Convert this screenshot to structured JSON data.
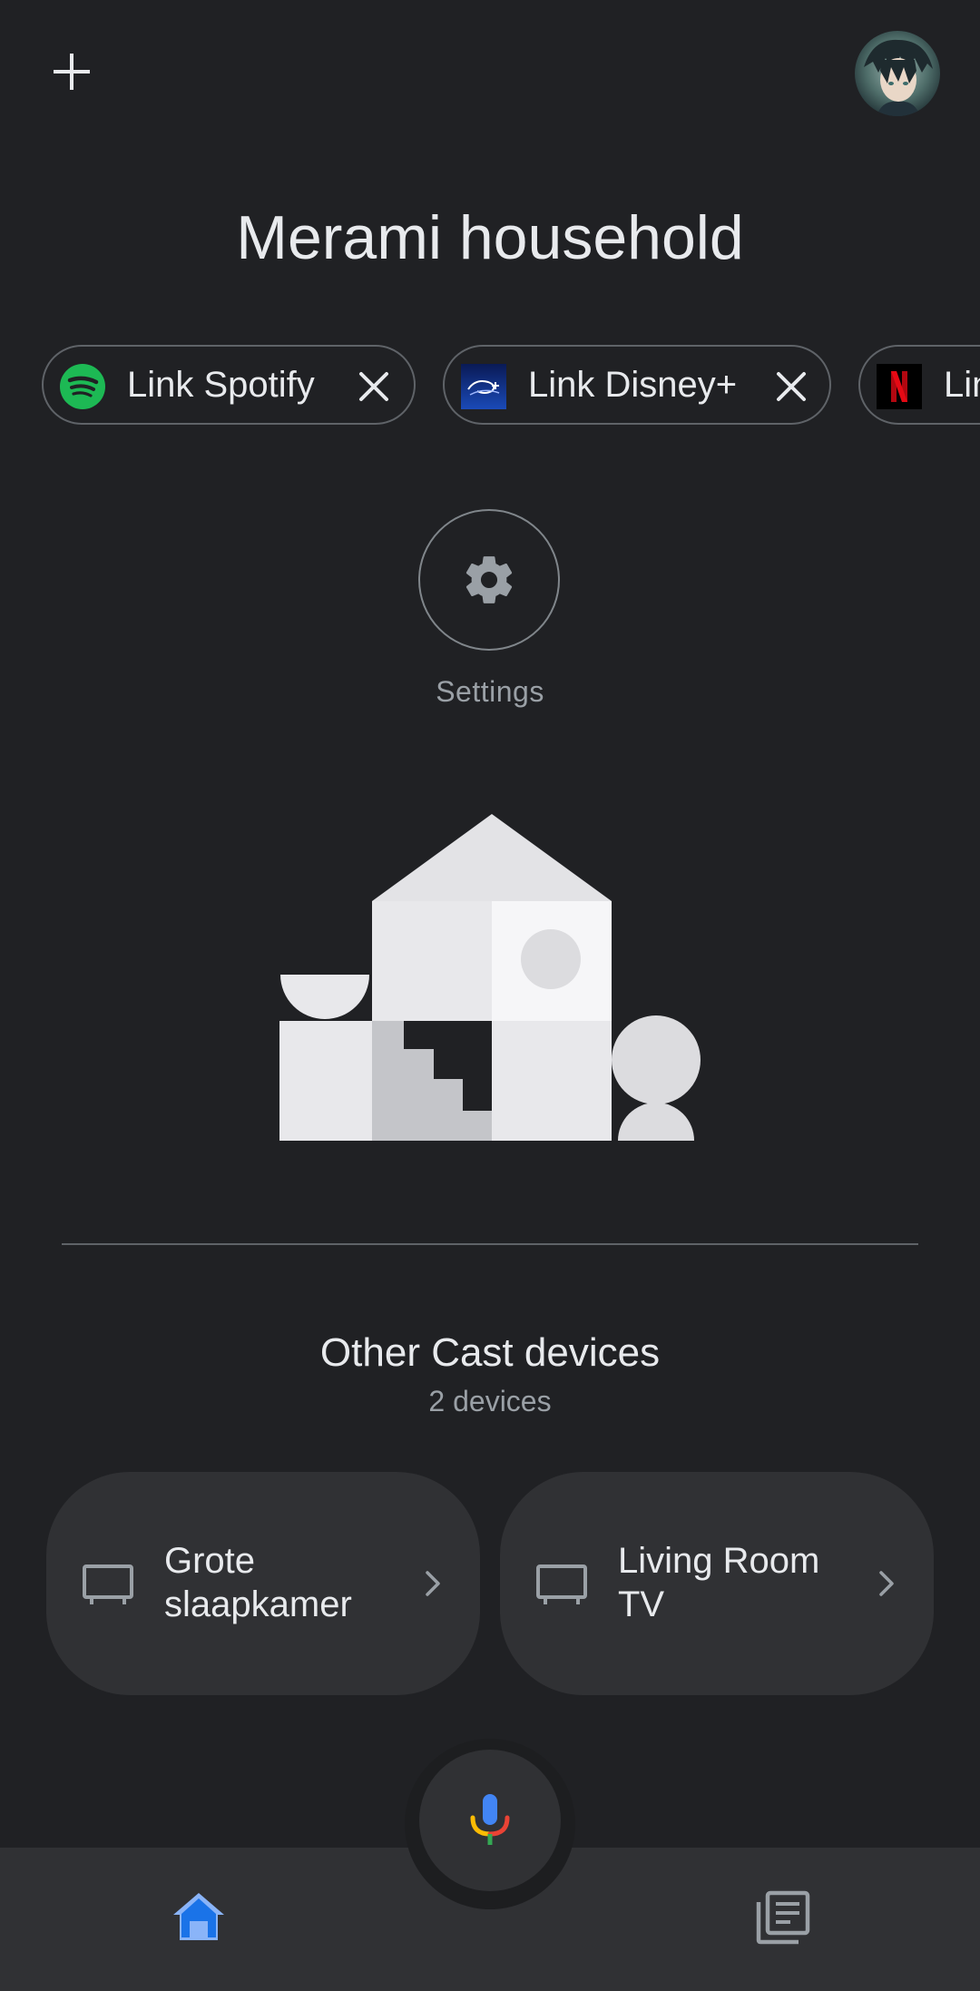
{
  "header": {
    "add_icon": "plus-icon",
    "avatar_icon": "user-avatar"
  },
  "home": {
    "title": "Merami household"
  },
  "chips": [
    {
      "label": "Link Spotify",
      "logo": "spotify-logo",
      "logo_color": "#1db954"
    },
    {
      "label": "Link Disney+",
      "logo": "disney-plus-logo",
      "logo_color": "#0d2b8f"
    },
    {
      "label": "Link Netflix",
      "logo": "netflix-logo",
      "logo_color": "#e50914"
    }
  ],
  "settings": {
    "label": "Settings",
    "icon": "gear-icon"
  },
  "cast_section": {
    "title": "Other Cast devices",
    "count": "2 devices",
    "devices": [
      {
        "label": "Grote slaapkamer",
        "icon": "tv-icon"
      },
      {
        "label": "Living Room TV",
        "icon": "tv-icon"
      }
    ]
  },
  "bottom_nav": {
    "home_icon": "home-icon",
    "feed_icon": "feed-icon",
    "mic_icon": "microphone-icon"
  },
  "colors": {
    "background": "#202124",
    "surface": "#303134",
    "accent": "#8ab4f8",
    "text_primary": "#e8eaed",
    "text_secondary": "#9aa0a6",
    "outline": "#5f6368"
  }
}
